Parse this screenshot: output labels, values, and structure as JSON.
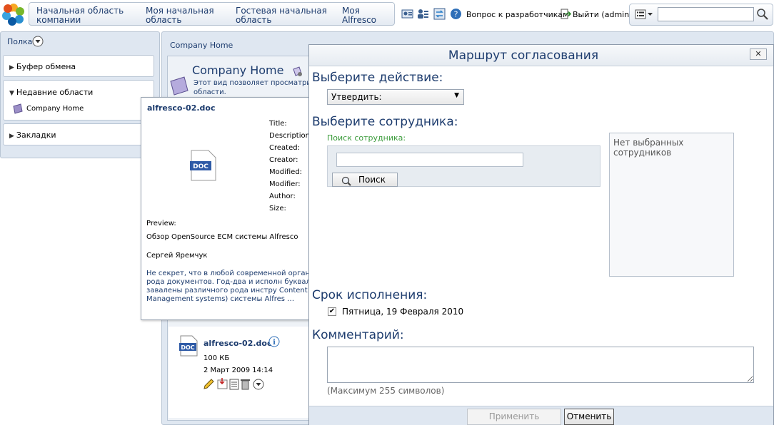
{
  "header": {
    "nav": [
      {
        "label": "Начальная область компании"
      },
      {
        "label": "Моя начальная область"
      },
      {
        "label": "Гостевая начальная область"
      },
      {
        "label": "Моя Alfresco"
      }
    ],
    "help_label": "Вопрос к разработчикам",
    "logout_label": "Выйти (admin)",
    "search_value": ""
  },
  "shelf": {
    "title": "Полка",
    "clipboard": "Буфер обмена",
    "recent": "Недавние области",
    "recent_item": "Company Home",
    "bookmarks": "Закладки"
  },
  "main": {
    "breadcrumb": "Company Home",
    "title": "Company Home",
    "description": "Этот вид позволяет просматри области."
  },
  "doc_popup": {
    "filename": "alfresco-02.doc",
    "meta_labels": [
      "Title:",
      "Description:",
      "Created:",
      "Creator:",
      "Modified:",
      "Modifier:",
      "Author:",
      "Size:"
    ],
    "preview_label": "Preview:",
    "preview_title": "Обзор OpenSource ECM системы Alfresco",
    "preview_author": "Сергей Яремчук",
    "preview_text": "Не секрет, что в любой современной органи разного рода документов. Год-два и исполн буквально завалены различного рода инстру Content Management systems) системы Alfres …"
  },
  "doc_item": {
    "filename": "alfresco-02.doc",
    "size": "100 КБ",
    "date": "2 Март 2009 14:14"
  },
  "dialog": {
    "title": "Маршрут согласования",
    "close": "✕",
    "action_heading": "Выберите действие:",
    "action_value": "Утвердить:",
    "employee_heading": "Выберите сотрудника:",
    "employee_search_label": "Поиск сотрудника:",
    "employee_search_value": "",
    "search_button": "Поиск",
    "selected_empty": "Нет выбранных сотрудников",
    "due_heading": "Срок исполнения:",
    "due_checked": true,
    "due_date": "Пятница, 19 Февраля 2010",
    "comment_heading": "Комментарий:",
    "comment_value": "",
    "comment_hint": "(Максимум 255 символов)",
    "apply": "Применить",
    "cancel": "Отменить"
  },
  "colors": {
    "title_blue": "#1d3c6e",
    "panel_bg": "#dfe7f1",
    "search_label_green": "#3a9b3a"
  }
}
